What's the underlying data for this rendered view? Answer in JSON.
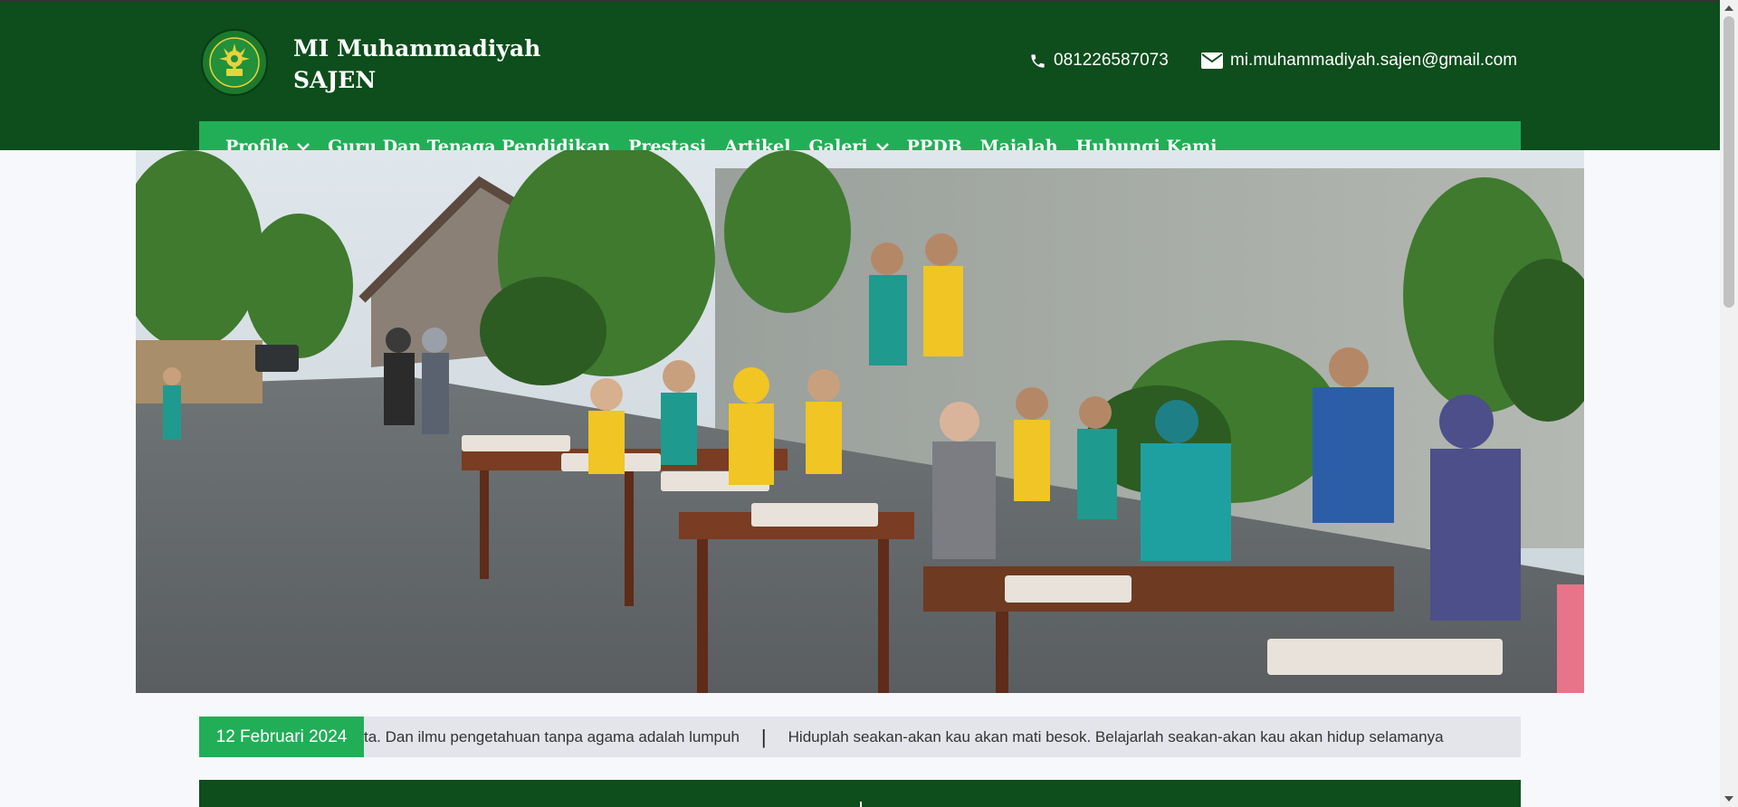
{
  "header": {
    "school_name_line1": "MI Muhammadiyah",
    "school_name_line2": "SAJEN",
    "phone": "081226587073",
    "email": "mi.muhammadiyah.sajen@gmail.com"
  },
  "nav": {
    "items": [
      {
        "label": "Profile",
        "has_dropdown": true
      },
      {
        "label": "Guru Dan Tenaga Pendidikan",
        "has_dropdown": false
      },
      {
        "label": "Prestasi",
        "has_dropdown": false
      },
      {
        "label": "Artikel",
        "has_dropdown": false
      },
      {
        "label": "Galeri",
        "has_dropdown": true
      },
      {
        "label": "PPDB",
        "has_dropdown": false
      },
      {
        "label": "Majalah",
        "has_dropdown": false
      },
      {
        "label": "Hubungi Kami",
        "has_dropdown": false
      }
    ]
  },
  "ticker": {
    "date": "12 Februari 2024",
    "quote1": "ta. Dan ilmu pengetahuan tanpa agama adalah lumpuh",
    "separator": "|",
    "quote2": "Hiduplah seakan-akan kau akan mati besok. Belajarlah seakan-akan kau akan hidup selamanya"
  },
  "colors": {
    "header_bg": "#0e4d1c",
    "nav_bg": "#22ae57",
    "nav_border": "#9fe05d",
    "ticker_bg": "#e4e5ea"
  },
  "icons": {
    "phone": "phone-icon",
    "email": "envelope-icon",
    "dropdown": "chevron-down-icon",
    "logo": "school-logo"
  }
}
